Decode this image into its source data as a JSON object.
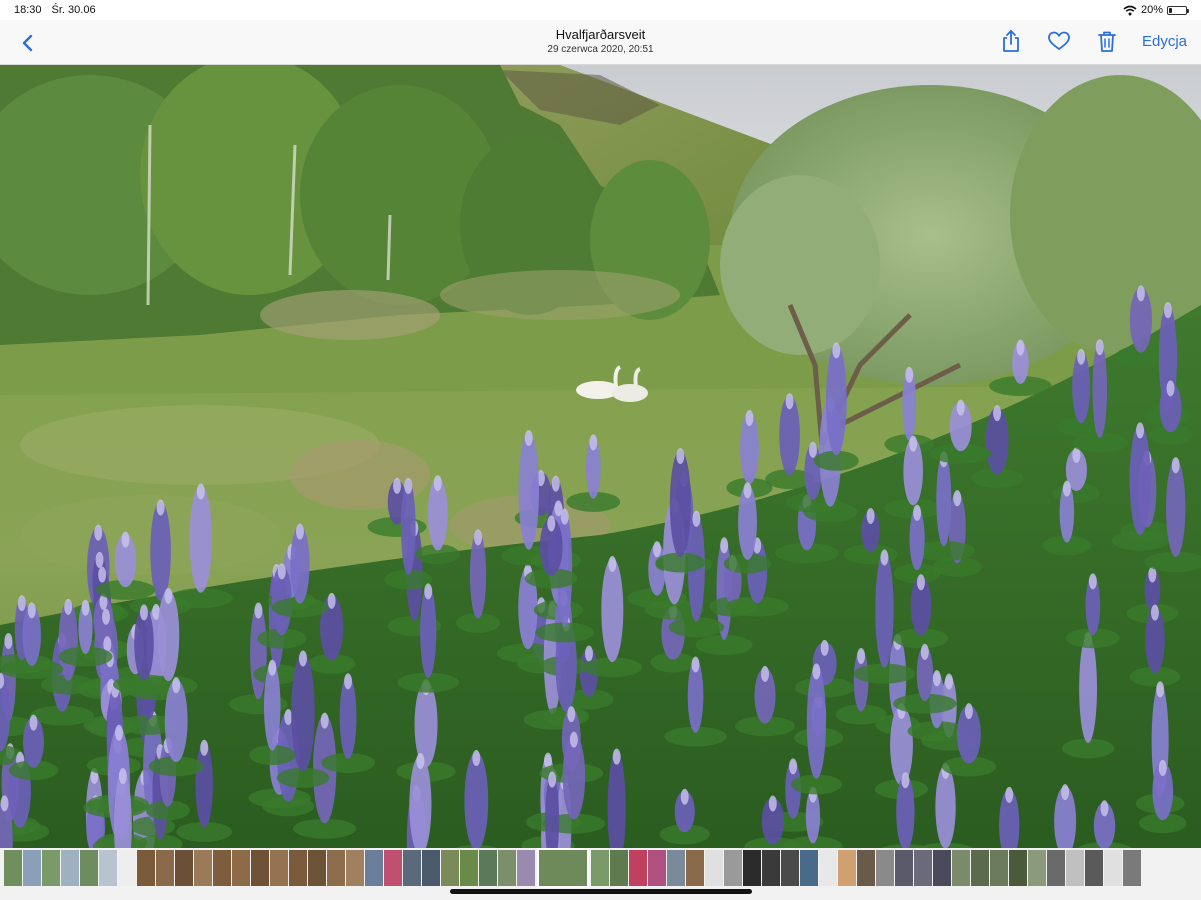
{
  "status_bar": {
    "time": "18:30",
    "date": "Śr. 30.06",
    "battery_percent": "20%",
    "battery_level": 0.2,
    "wifi_icon": "wifi-icon",
    "battery_icon": "battery-icon"
  },
  "nav": {
    "back_icon": "chevron-left-icon",
    "title": "Hvalfjarðarsveit",
    "date": "29 czerwca 2020, 20:51",
    "share_icon": "share-icon",
    "favorite_icon": "heart-icon",
    "delete_icon": "trash-icon",
    "edit_label": "Edycja"
  },
  "colors": {
    "accent": "#2a6fdb",
    "nav_background": "#f8f8f8"
  },
  "photo": {
    "subject": "lupine-meadow-with-swans"
  },
  "filmstrip": {
    "thumbnail_colors": [
      "#6f8f5c",
      "#8aa0b8",
      "#7b9a6a",
      "#9fb0c0",
      "#6d8c60",
      "#b7c4cf",
      "#eeeeee",
      "#7b5a3c",
      "#8a6a4a",
      "#6b4f36",
      "#9a7a58",
      "#7e5c3e",
      "#8e6b48",
      "#6f5236",
      "#957350",
      "#7a5a3b",
      "#6c5338",
      "#8c6c4c",
      "#a08060",
      "#6a7e9a",
      "#c05070",
      "#5a6a7a",
      "#4a5a6a",
      "#7a8a5a",
      "#6a8a4a",
      "#5a7a5a",
      "#7b8f6a",
      "#9a8ab0",
      "#6f8a5a",
      "#7a9a6a",
      "#5e7a4e",
      "#c04060",
      "#b05080",
      "#7a8a9a",
      "#8a6a4a",
      "#e0e0e0",
      "#9a9a9a",
      "#2a2a2a",
      "#3a3a3a",
      "#4a4a4a",
      "#4a6a8a",
      "#e8e8e8",
      "#d0a070",
      "#6a5a4a",
      "#8a8a8a",
      "#5a5a6a",
      "#6a6a7a",
      "#4a4a5a",
      "#7a8a6a",
      "#5a6a4a",
      "#6a7a5a",
      "#4a5a3a",
      "#8a9a7a",
      "#6a6a6a",
      "#c0c0c0",
      "#5a5a5a",
      "#e0e0e0",
      "#7a7a7a"
    ],
    "selected_index": 28
  }
}
